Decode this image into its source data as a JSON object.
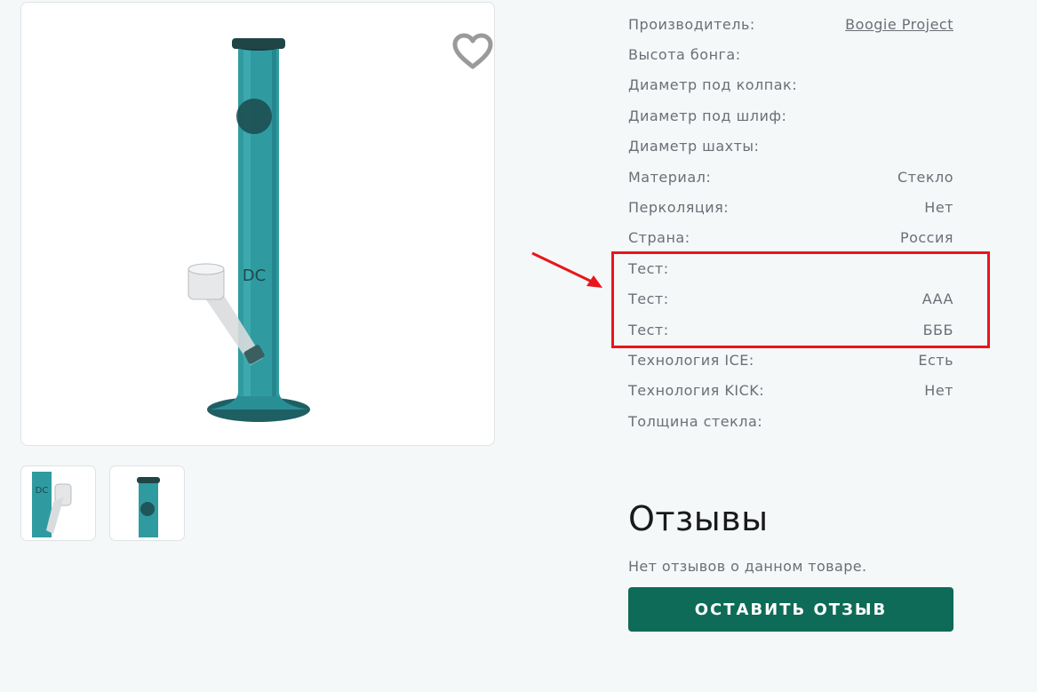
{
  "product": {
    "favorite_icon": "heart-icon",
    "bong_color": "#2a8f95"
  },
  "thumbnails": [
    {
      "name": "thumb-1"
    },
    {
      "name": "thumb-2"
    }
  ],
  "specs": [
    {
      "label": "Производитель:",
      "value": "Boogie Project",
      "link": true
    },
    {
      "label": "Высота бонга:",
      "value": ""
    },
    {
      "label": "Диаметр под колпак:",
      "value": ""
    },
    {
      "label": "Диаметр под шлиф:",
      "value": ""
    },
    {
      "label": "Диаметр шахты:",
      "value": ""
    },
    {
      "label": "Материал:",
      "value": "Стекло"
    },
    {
      "label": "Перколяция:",
      "value": "Нет"
    },
    {
      "label": "Страна:",
      "value": "Россия"
    },
    {
      "label": "Тест:",
      "value": ""
    },
    {
      "label": "Тест:",
      "value": "AAA"
    },
    {
      "label": "Тест:",
      "value": "БББ"
    },
    {
      "label": "Технология ICE:",
      "value": "Есть"
    },
    {
      "label": "Технология KICK:",
      "value": "Нет"
    },
    {
      "label": "Толщина стекла:",
      "value": ""
    }
  ],
  "reviews": {
    "title": "Отзывы",
    "empty_text": "Нет отзывов о данном товаре.",
    "button_label": "ОСТАВИТЬ ОТЗЫВ"
  },
  "annotation": {
    "highlight_color": "#e8161b"
  },
  "colors": {
    "accent": "#0d6b57",
    "text": "#6b6f76",
    "heading": "#1a1a1a"
  }
}
